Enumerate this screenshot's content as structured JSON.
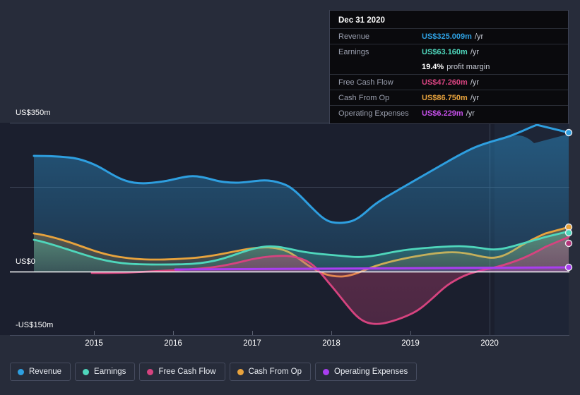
{
  "colors": {
    "background": "#272c3a",
    "plot_bg_left": "#1c2030",
    "plot_bg_right": "#20283b",
    "grid": "#3f4758",
    "zero_line": "#ffffff",
    "revenue": "#2e9fe0",
    "earnings": "#4fd7bc",
    "free_cash_flow": "#d6437f",
    "cash_from_op": "#e8a33d",
    "operating_expenses": "#a93ef0",
    "tooltip_bg": "#0a0a0d",
    "tooltip_border": "#3c4152",
    "axis_text": "#ffffff"
  },
  "tooltip": {
    "title": "Dec 31 2020",
    "rows": [
      {
        "key": "Revenue",
        "value": "US$325.009m",
        "unit": "/yr",
        "color": "#2e9fe0"
      },
      {
        "key": "Earnings",
        "value": "US$63.160m",
        "unit": "/yr",
        "color": "#4fd7bc"
      },
      {
        "key": "Free Cash Flow",
        "value": "US$47.260m",
        "unit": "/yr",
        "color": "#d6437f"
      },
      {
        "key": "Cash From Op",
        "value": "US$86.750m",
        "unit": "/yr",
        "color": "#e8a33d"
      },
      {
        "key": "Operating Expenses",
        "value": "US$6.229m",
        "unit": "/yr",
        "color": "#c44fe8"
      }
    ],
    "profit_margin_value": "19.4%",
    "profit_margin_label": "profit margin"
  },
  "legend": {
    "items": [
      {
        "label": "Revenue",
        "color": "#2e9fe0"
      },
      {
        "label": "Earnings",
        "color": "#4fd7bc"
      },
      {
        "label": "Free Cash Flow",
        "color": "#d6437f"
      },
      {
        "label": "Cash From Op",
        "color": "#e8a33d"
      },
      {
        "label": "Operating Expenses",
        "color": "#a93ef0"
      }
    ]
  },
  "axes": {
    "y_labels": [
      {
        "text": "US$350m"
      },
      {
        "text": "US$0"
      },
      {
        "text": "-US$150m"
      }
    ],
    "x_labels": [
      "2015",
      "2016",
      "2017",
      "2018",
      "2019",
      "2020"
    ]
  },
  "chart_data": {
    "type": "area",
    "title": "",
    "xlabel": "",
    "ylabel": "",
    "ylim": [
      -150,
      350
    ],
    "xlim": [
      "2014.5",
      "2021.0"
    ],
    "grid": true,
    "legend_position": "bottom",
    "y_ticks": [
      350,
      175,
      0,
      -150
    ],
    "y_tick_labels": [
      "US$350m",
      "",
      "US$0",
      "-US$150m"
    ],
    "x_ticks": [
      2015,
      2016,
      2017,
      2018,
      2019,
      2020
    ],
    "units": "US$ millions per year",
    "highlight_date": "Dec 31 2020",
    "x": [
      2014.55,
      2014.8,
      2015.05,
      2015.3,
      2015.55,
      2015.8,
      2016.05,
      2016.3,
      2016.55,
      2016.8,
      2017.05,
      2017.3,
      2017.55,
      2017.8,
      2018.05,
      2018.3,
      2018.55,
      2018.8,
      2019.05,
      2019.3,
      2019.55,
      2019.8,
      2020.05,
      2020.3,
      2020.55,
      2020.85
    ],
    "series": [
      {
        "name": "Revenue",
        "color": "#2e9fe0",
        "values": [
          245,
          243,
          228,
          205,
          192,
          190,
          198,
          196,
          193,
          190,
          196,
          203,
          196,
          191,
          188,
          186,
          178,
          163,
          148,
          138,
          138,
          152,
          175,
          198,
          222,
          242,
          262,
          282,
          296,
          325
        ]
      },
      {
        "name": "Earnings",
        "color": "#4fd7bc",
        "values": [
          48,
          45,
          40,
          33,
          27,
          22,
          18,
          14,
          11,
          10,
          10,
          11,
          13,
          17,
          22,
          28,
          32,
          34,
          33,
          30,
          25,
          20,
          17,
          16,
          18,
          22,
          28,
          35,
          45,
          63
        ]
      },
      {
        "name": "Free Cash Flow",
        "color": "#d6437f",
        "values": [
          null,
          null,
          null,
          -2,
          -3,
          -3,
          -2,
          0,
          2,
          5,
          9,
          14,
          19,
          23,
          26,
          27,
          24,
          10,
          -20,
          -60,
          -100,
          -120,
          -122,
          -115,
          -95,
          -60,
          -25,
          -5,
          18,
          47
        ]
      },
      {
        "name": "Cash From Op",
        "color": "#e8a33d",
        "values": [
          59,
          56,
          50,
          43,
          37,
          31,
          27,
          24,
          22,
          21,
          22,
          24,
          27,
          30,
          33,
          35,
          35,
          32,
          24,
          12,
          2,
          -6,
          -8,
          -4,
          6,
          18,
          30,
          42,
          58,
          87
        ]
      },
      {
        "name": "Operating Expenses",
        "color": "#a93ef0",
        "values": [
          null,
          null,
          null,
          null,
          null,
          null,
          null,
          null,
          2,
          2,
          2,
          2,
          3,
          3,
          3,
          3,
          3,
          3,
          3,
          3,
          3,
          3,
          3,
          4,
          4,
          4,
          5,
          5,
          6,
          6
        ]
      }
    ]
  }
}
